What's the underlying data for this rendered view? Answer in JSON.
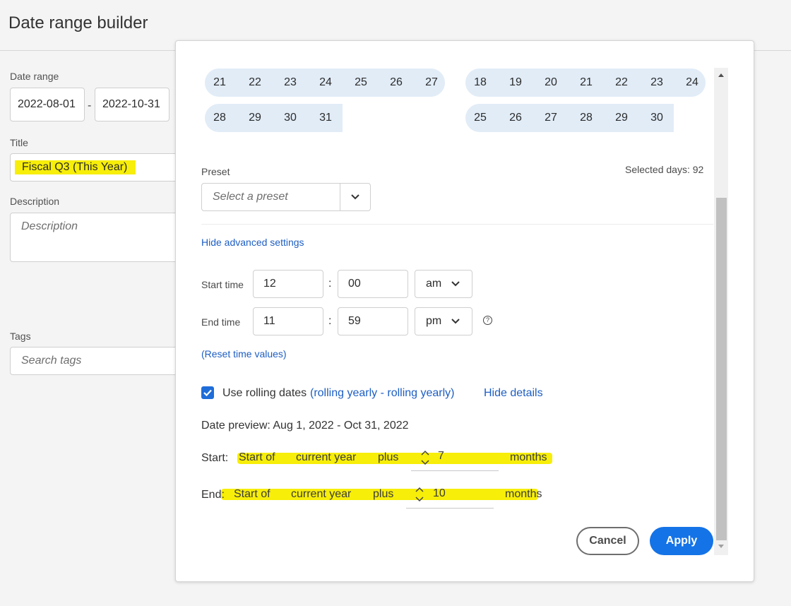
{
  "page": {
    "title": "Date range builder"
  },
  "left_panel": {
    "date_range_label": "Date range",
    "start_date": "2022-08-01",
    "separator": "-",
    "end_date": "2022-10-31",
    "title_label": "Title",
    "title_value": "Fiscal Q3 (This Year)",
    "description_label": "Description",
    "description_placeholder": "Description",
    "tags_label": "Tags",
    "tags_placeholder": "Search tags"
  },
  "calendar": {
    "left_month": {
      "rows": [
        [
          "21",
          "22",
          "23",
          "24",
          "25",
          "26",
          "27"
        ],
        [
          "28",
          "29",
          "30",
          "31"
        ]
      ]
    },
    "right_month": {
      "rows": [
        [
          "18",
          "19",
          "20",
          "21",
          "22",
          "23",
          "24"
        ],
        [
          "25",
          "26",
          "27",
          "28",
          "29",
          "30"
        ]
      ]
    }
  },
  "preset": {
    "label": "Preset",
    "placeholder": "Select a preset",
    "selected_days": "Selected days: 92"
  },
  "advanced": {
    "hide_link": "Hide advanced settings",
    "start_time_label": "Start time",
    "start_hour": "12",
    "start_minute": "00",
    "start_ampm": "am",
    "end_time_label": "End time",
    "end_hour": "11",
    "end_minute": "59",
    "end_ampm": "pm",
    "colon": ":",
    "help_icon": "?",
    "reset_link": "(Reset time values)"
  },
  "rolling": {
    "checked": true,
    "label": "Use rolling dates",
    "summary_link": "(rolling yearly - rolling yearly)",
    "hide_details": "Hide details",
    "date_preview": "Date preview: Aug 1, 2022 - Oct 31, 2022",
    "start": {
      "label": "Start:",
      "anchor": "Start of",
      "period": "current year",
      "op": "plus",
      "value": "7",
      "unit": "months"
    },
    "end": {
      "label": "End:",
      "anchor": "Start of",
      "period": "current year",
      "op": "plus",
      "value": "10",
      "unit": "months"
    }
  },
  "buttons": {
    "cancel": "Cancel",
    "apply": "Apply"
  },
  "colors": {
    "accent": "#1473e6",
    "link": "#1d5ec3",
    "highlight": "#f7ee09",
    "range_bg": "#e1ecf7"
  }
}
